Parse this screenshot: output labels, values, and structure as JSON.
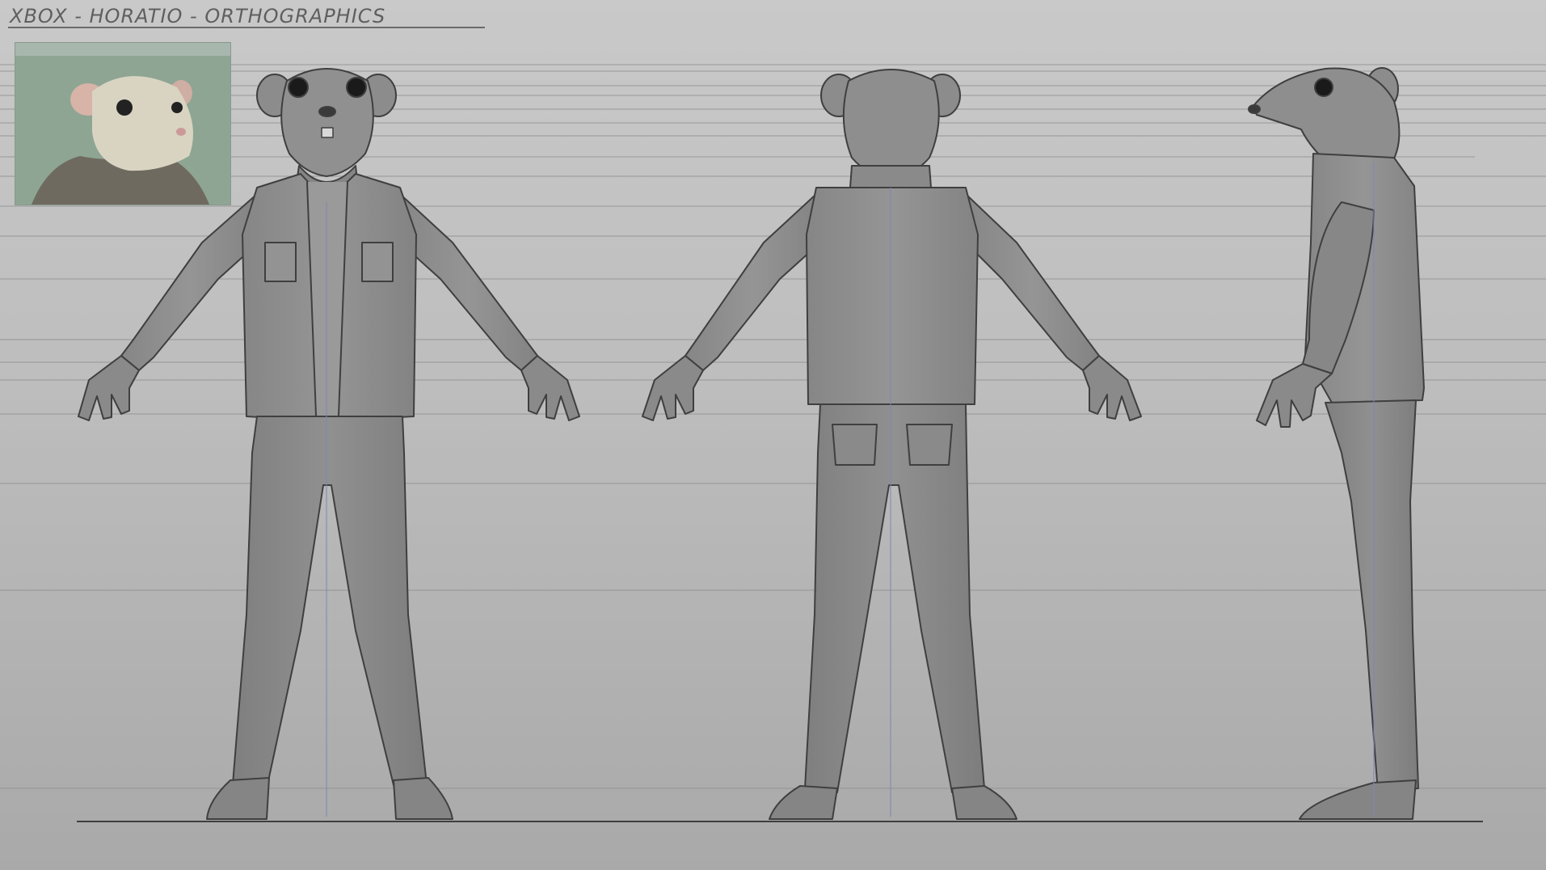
{
  "sheet": {
    "title": "XBOX - HORATIO - ORTHOGRAPHICS"
  },
  "colors": {
    "background_top": "#c9c9c9",
    "background_bottom": "#a9a9a9",
    "figure_fill": "#8f8f8f",
    "figure_shadow": "#7c7c7c",
    "line_art": "#3f3f3f",
    "construction_line": "#7d87b5",
    "guide_line": "#8a8a8a",
    "reference_photo_bg": "#8ea593"
  },
  "figures": [
    {
      "view": "front",
      "icon": "rat-character-front-view"
    },
    {
      "view": "back",
      "icon": "rat-character-back-view"
    },
    {
      "view": "side",
      "icon": "rat-character-side-view"
    }
  ],
  "reference": {
    "icon": "rat-reference-photo"
  }
}
